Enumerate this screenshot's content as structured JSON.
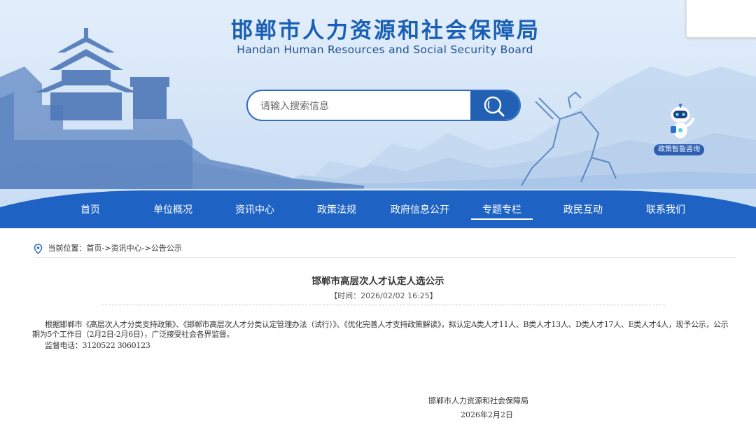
{
  "header": {
    "title_cn": "邯郸市人力资源和社会保障局",
    "title_en": "Handan Human Resources and Social Security Board"
  },
  "search": {
    "placeholder": "请输入搜索信息",
    "button_icon": "search-icon"
  },
  "assistant": {
    "label": "政策智能咨询",
    "icon": "robot-icon"
  },
  "nav": {
    "items": [
      {
        "label": "首页"
      },
      {
        "label": "单位概况"
      },
      {
        "label": "资讯中心"
      },
      {
        "label": "政策法规"
      },
      {
        "label": "政府信息公开"
      },
      {
        "label": "专题专栏",
        "active": true
      },
      {
        "label": "政民互动"
      },
      {
        "label": "联系我们"
      }
    ]
  },
  "breadcrumb": {
    "icon": "location-pin-icon",
    "prefix": "当前位置：",
    "path": "首页->资讯中心->公告公示"
  },
  "article": {
    "title": "邯郸市高层次人才认定人选公示",
    "meta": "【时间：2026/02/02 16:25】",
    "body": "根据邯郸市《高层次人才分类支持政策》、《邯郸市高层次人才分类认定管理办法（试行）》、《优化完善人才支持政策解读》，拟认定A类人才11人、B类人才13人、D类人才17人、E类人才4人，现予公示，公示期为5个工作日（2月2日-2月6日），广泛接受社会各界监督。",
    "phone": "监督电话：3120522   3060123",
    "sign_org": "邯郸市人力资源和社会保障局",
    "sign_date": "2026年2月2日"
  },
  "colors": {
    "brand_blue": "#1a5fb4",
    "nav_blue": "#1e63c4",
    "banner_bg": "#d6e6f7"
  }
}
